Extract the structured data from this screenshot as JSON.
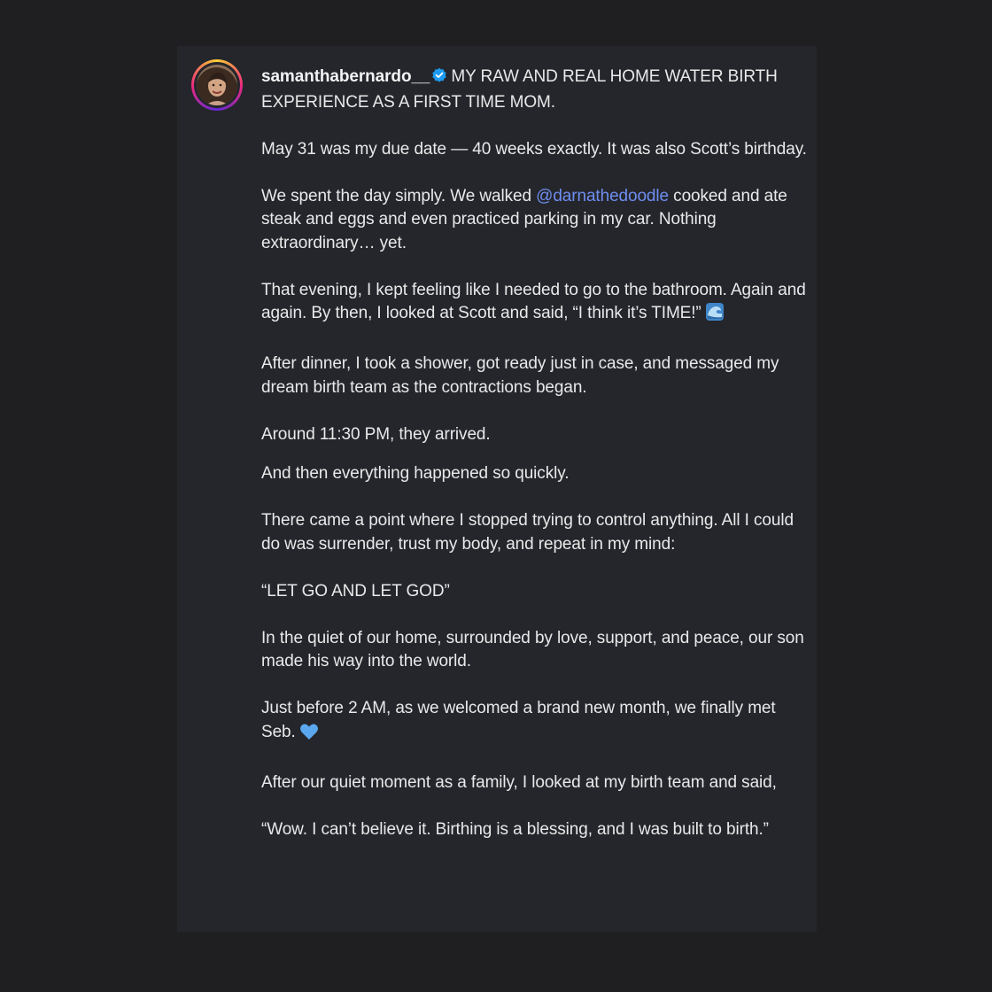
{
  "post": {
    "username": "samanthabernardo__",
    "headline": "MY RAW AND REAL HOME WATER BIRTH EXPERIENCE AS A FIRST TIME MOM.",
    "paragraphs": [
      "May 31 was my due date — 40 weeks exactly. It was also Scott’s birthday.",
      {
        "before": "We spent the day simply. We walked ",
        "mention": "@darnathedoodle",
        "after": " cooked and ate steak and eggs and even practiced parking in my car. Nothing extraordinary… yet."
      },
      "That evening, I kept feeling like I needed to go to the bathroom. Again and again. By then, I looked at Scott and said, “I think it’s TIME!”",
      "After dinner, I took a shower, got ready just in case, and messaged my dream birth team as the contractions began.",
      "Around 11:30 PM, they arrived.",
      "And then everything happened so quickly.",
      "There came a point where I stopped trying to control anything. All I could do was surrender, trust my body, and repeat in my mind:",
      "“LET GO AND LET GOD”",
      "In the quiet of our home, surrounded by love, support, and peace, our son made his way into the world.",
      "Just before 2 AM, as we welcomed a brand new month, we finally met Seb.",
      "After our quiet moment as a family, I looked at my birth team and said,",
      "“Wow. I can’t believe it. Birthing is a blessing, and I was built to birth.”"
    ]
  },
  "icons": {
    "verified": "verified-badge-icon",
    "wave_emoji": "wave-emoji-icon",
    "heart_emoji": "blue-heart-emoji-icon"
  },
  "colors": {
    "page_background": "#1f1f21",
    "card_background": "#24262b",
    "text": "#e9e9ea",
    "mention": "#6f8df0",
    "verified": "#1d9bf0"
  }
}
